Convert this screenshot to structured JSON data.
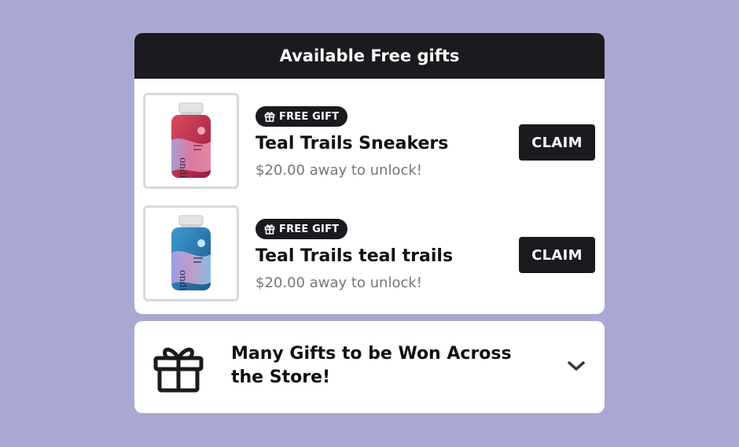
{
  "panel": {
    "title": "Available Free gifts"
  },
  "gifts": [
    {
      "badge": "FREE GIFT",
      "name": "Teal Trails Sneakers",
      "subtitle": "$20.00 away to unlock!",
      "button": "CLAIM",
      "bottle_color": "#c23a53",
      "image_icon": "supplement-bottle-red"
    },
    {
      "badge": "FREE GIFT",
      "name": "Teal Trails teal trails",
      "subtitle": "$20.00 away to unlock!",
      "button": "CLAIM",
      "bottle_color": "#2b7fb8",
      "image_icon": "supplement-bottle-blue"
    }
  ],
  "promo": {
    "text": "Many Gifts to be Won Across the Store!",
    "icon": "gift-icon",
    "toggle_icon": "chevron-down-icon"
  },
  "colors": {
    "background": "#a8a8d2",
    "dark": "#1c1a1e",
    "muted_text": "#76767a"
  }
}
